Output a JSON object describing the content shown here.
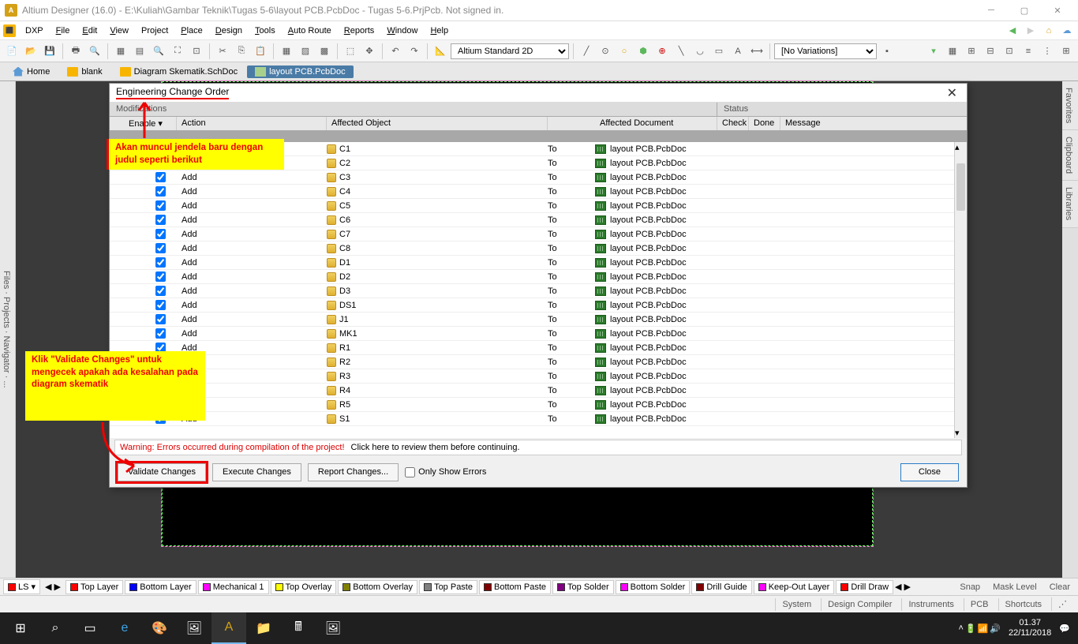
{
  "window": {
    "title": "Altium Designer (16.0) - E:\\Kuliah\\Gambar Teknik\\Tugas 5-6\\layout PCB.PcbDoc - Tugas 5-6.PrjPcb. Not signed in."
  },
  "menu": {
    "dxp": "DXP",
    "items": [
      "File",
      "Edit",
      "View",
      "Project",
      "Place",
      "Design",
      "Tools",
      "Auto Route",
      "Reports",
      "Window",
      "Help"
    ]
  },
  "toolbar": {
    "viewMode": "Altium Standard 2D",
    "variations": "[No Variations]"
  },
  "tabs": {
    "home": "Home",
    "blank": "blank",
    "schematic": "Diagram Skematik.SchDoc",
    "pcb": "layout PCB.PcbDoc"
  },
  "sidePanels": {
    "left": "Files · Projects · Navigator · ...",
    "right": [
      "Favorites",
      "Clipboard",
      "Libraries"
    ]
  },
  "eco": {
    "title": "Engineering Change Order",
    "headers": {
      "modifications": "Modifications",
      "status": "Status"
    },
    "cols": {
      "enable": "Enable",
      "action": "Action",
      "affectedObject": "Affected Object",
      "affectedDocument": "Affected Document",
      "check": "Check",
      "done": "Done",
      "message": "Message"
    },
    "to": "To",
    "docName": "layout PCB.PcbDoc",
    "action": "Add",
    "rows": [
      "C1",
      "C2",
      "C3",
      "C4",
      "C5",
      "C6",
      "C7",
      "C8",
      "D1",
      "D2",
      "D3",
      "DS1",
      "J1",
      "MK1",
      "R1",
      "R2",
      "R3",
      "R4",
      "R5",
      "S1"
    ],
    "warning": {
      "red": "Warning: Errors occurred during compilation of the project!",
      "rest": "Click here to review them before continuing."
    },
    "buttons": {
      "validate": "Validate Changes",
      "execute": "Execute Changes",
      "report": "Report Changes...",
      "onlyErrors": "Only Show Errors",
      "close": "Close"
    }
  },
  "annotations": {
    "a1": "Akan muncul jendela baru dengan judul seperti berikut",
    "a2": "Klik \"Validate Changes\" untuk mengecek apakah ada kesalahan pada diagram skematik"
  },
  "layers": {
    "ls": "LS",
    "items": [
      {
        "name": "Top Layer",
        "color": "#ff0000"
      },
      {
        "name": "Bottom Layer",
        "color": "#0000ff"
      },
      {
        "name": "Mechanical 1",
        "color": "#ff00ff"
      },
      {
        "name": "Top Overlay",
        "color": "#ffff00"
      },
      {
        "name": "Bottom Overlay",
        "color": "#808000"
      },
      {
        "name": "Top Paste",
        "color": "#808080"
      },
      {
        "name": "Bottom Paste",
        "color": "#800000"
      },
      {
        "name": "Top Solder",
        "color": "#800080"
      },
      {
        "name": "Bottom Solder",
        "color": "#ff00ff"
      },
      {
        "name": "Drill Guide",
        "color": "#800000"
      },
      {
        "name": "Keep-Out Layer",
        "color": "#ff00ff"
      },
      {
        "name": "Drill Draw",
        "color": "#ff0000"
      }
    ],
    "right": [
      "Snap",
      "Mask Level",
      "Clear"
    ]
  },
  "status": {
    "items": [
      "System",
      "Design Compiler",
      "Instruments",
      "PCB",
      "Shortcuts"
    ]
  },
  "taskbar": {
    "time": "01.37",
    "date": "22/11/2018"
  }
}
